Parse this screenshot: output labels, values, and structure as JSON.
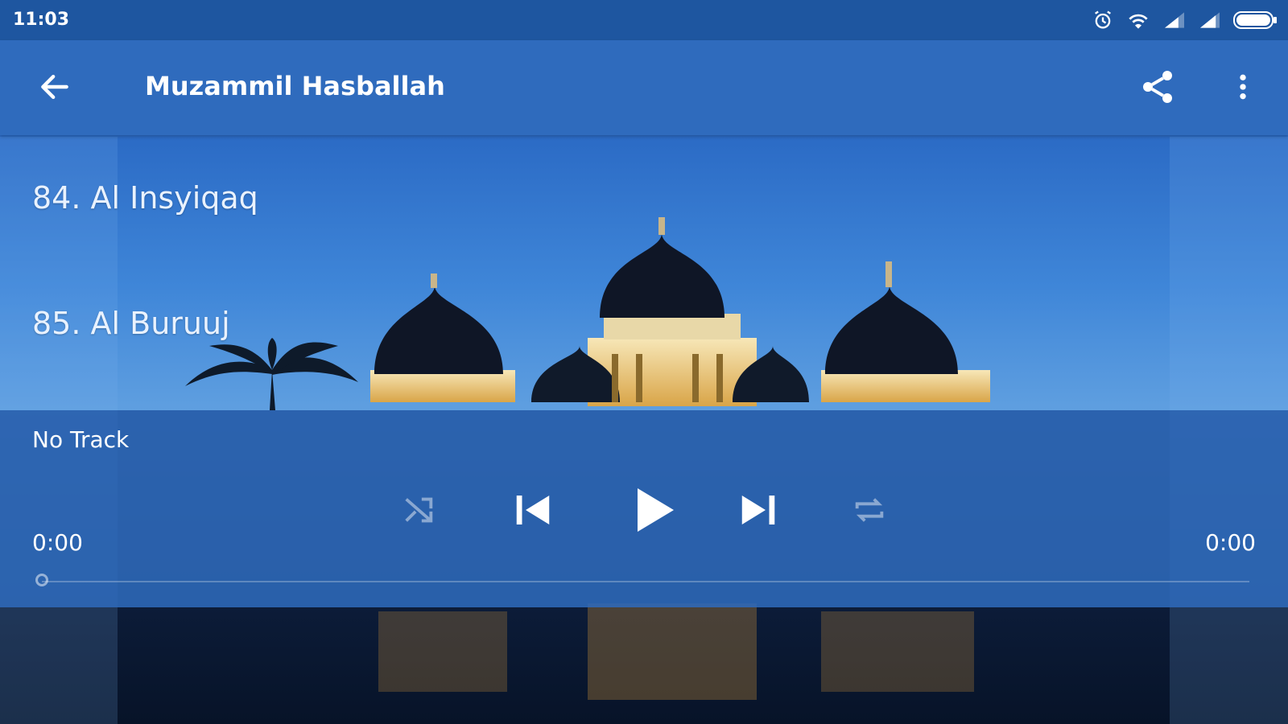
{
  "status_bar": {
    "time": "11:03",
    "icons": [
      "alarm-icon",
      "wifi-icon",
      "signal-icon",
      "signal-icon",
      "battery-icon"
    ]
  },
  "app_bar": {
    "title": "Muzammil Hasballah",
    "icons": [
      "back-arrow-icon",
      "share-icon",
      "more-vertical-icon"
    ]
  },
  "track_list": [
    {
      "label": "84. Al Insyiqaq"
    },
    {
      "label": "85. Al Buruuj"
    }
  ],
  "player": {
    "track_name": "No Track",
    "elapsed": "0:00",
    "duration": "0:00",
    "progress_fraction": 0.0,
    "controls": [
      "shuffle-icon",
      "previous-icon",
      "play-icon",
      "next-icon",
      "repeat-icon"
    ]
  },
  "colors": {
    "status_bar": "#1e56a0",
    "app_bar": "#2f6bbd",
    "player_panel": "#2f6bbd",
    "text": "#ffffff"
  }
}
